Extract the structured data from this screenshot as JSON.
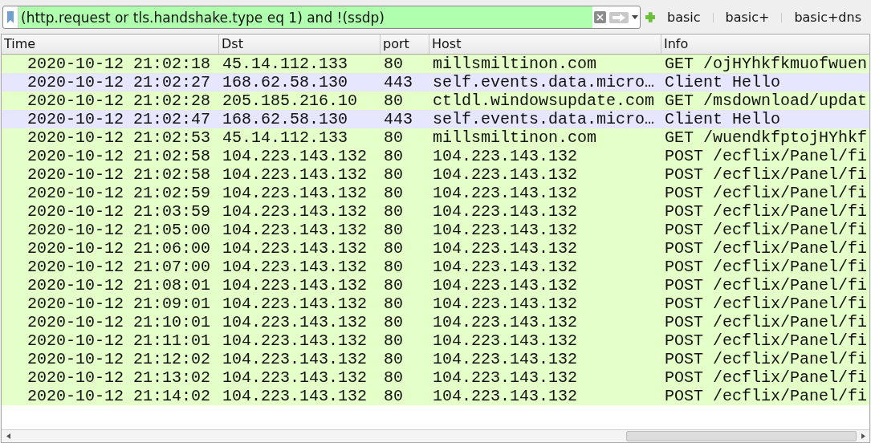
{
  "filter": {
    "value": "(http.request or tls.handshake.type eq 1) and !(ssdp)"
  },
  "buttons": [
    "basic",
    "basic+",
    "basic+dns"
  ],
  "table": {
    "columns": [
      "Time",
      "Dst",
      "port",
      "Host",
      "Info"
    ],
    "rows": [
      {
        "kind": "http",
        "cells": [
          "2020-10-12 21:02:18",
          "45.14.112.133",
          "80",
          "millsmiltinon.com",
          "GET /ojHYhkfkmuofwuen"
        ]
      },
      {
        "kind": "tls",
        "cells": [
          "2020-10-12 21:02:27",
          "168.62.58.130",
          "443",
          "self.events.data.micro…",
          "Client Hello"
        ]
      },
      {
        "kind": "http",
        "cells": [
          "2020-10-12 21:02:28",
          "205.185.216.10",
          "80",
          "ctldl.windowsupdate.com",
          "GET /msdownload/updat"
        ]
      },
      {
        "kind": "tls",
        "cells": [
          "2020-10-12 21:02:47",
          "168.62.58.130",
          "443",
          "self.events.data.micro…",
          "Client Hello"
        ]
      },
      {
        "kind": "http",
        "cells": [
          "2020-10-12 21:02:53",
          "45.14.112.133",
          "80",
          "millsmiltinon.com",
          "GET /wuendkfptojHYhkf"
        ]
      },
      {
        "kind": "http",
        "cells": [
          "2020-10-12 21:02:58",
          "104.223.143.132",
          "80",
          "104.223.143.132",
          "POST /ecflix/Panel/fi"
        ]
      },
      {
        "kind": "http",
        "cells": [
          "2020-10-12 21:02:58",
          "104.223.143.132",
          "80",
          "104.223.143.132",
          "POST /ecflix/Panel/fi"
        ]
      },
      {
        "kind": "http",
        "cells": [
          "2020-10-12 21:02:59",
          "104.223.143.132",
          "80",
          "104.223.143.132",
          "POST /ecflix/Panel/fi"
        ]
      },
      {
        "kind": "http",
        "cells": [
          "2020-10-12 21:03:59",
          "104.223.143.132",
          "80",
          "104.223.143.132",
          "POST /ecflix/Panel/fi"
        ]
      },
      {
        "kind": "http",
        "cells": [
          "2020-10-12 21:05:00",
          "104.223.143.132",
          "80",
          "104.223.143.132",
          "POST /ecflix/Panel/fi"
        ]
      },
      {
        "kind": "http",
        "cells": [
          "2020-10-12 21:06:00",
          "104.223.143.132",
          "80",
          "104.223.143.132",
          "POST /ecflix/Panel/fi"
        ]
      },
      {
        "kind": "http",
        "cells": [
          "2020-10-12 21:07:00",
          "104.223.143.132",
          "80",
          "104.223.143.132",
          "POST /ecflix/Panel/fi"
        ]
      },
      {
        "kind": "http",
        "cells": [
          "2020-10-12 21:08:01",
          "104.223.143.132",
          "80",
          "104.223.143.132",
          "POST /ecflix/Panel/fi"
        ]
      },
      {
        "kind": "http",
        "cells": [
          "2020-10-12 21:09:01",
          "104.223.143.132",
          "80",
          "104.223.143.132",
          "POST /ecflix/Panel/fi"
        ]
      },
      {
        "kind": "http",
        "cells": [
          "2020-10-12 21:10:01",
          "104.223.143.132",
          "80",
          "104.223.143.132",
          "POST /ecflix/Panel/fi"
        ]
      },
      {
        "kind": "http",
        "cells": [
          "2020-10-12 21:11:01",
          "104.223.143.132",
          "80",
          "104.223.143.132",
          "POST /ecflix/Panel/fi"
        ]
      },
      {
        "kind": "http",
        "cells": [
          "2020-10-12 21:12:02",
          "104.223.143.132",
          "80",
          "104.223.143.132",
          "POST /ecflix/Panel/fi"
        ]
      },
      {
        "kind": "http",
        "cells": [
          "2020-10-12 21:13:02",
          "104.223.143.132",
          "80",
          "104.223.143.132",
          "POST /ecflix/Panel/fi"
        ]
      },
      {
        "kind": "http",
        "cells": [
          "2020-10-12 21:14:02",
          "104.223.143.132",
          "80",
          "104.223.143.132",
          "POST /ecflix/Panel/fi"
        ]
      }
    ]
  }
}
